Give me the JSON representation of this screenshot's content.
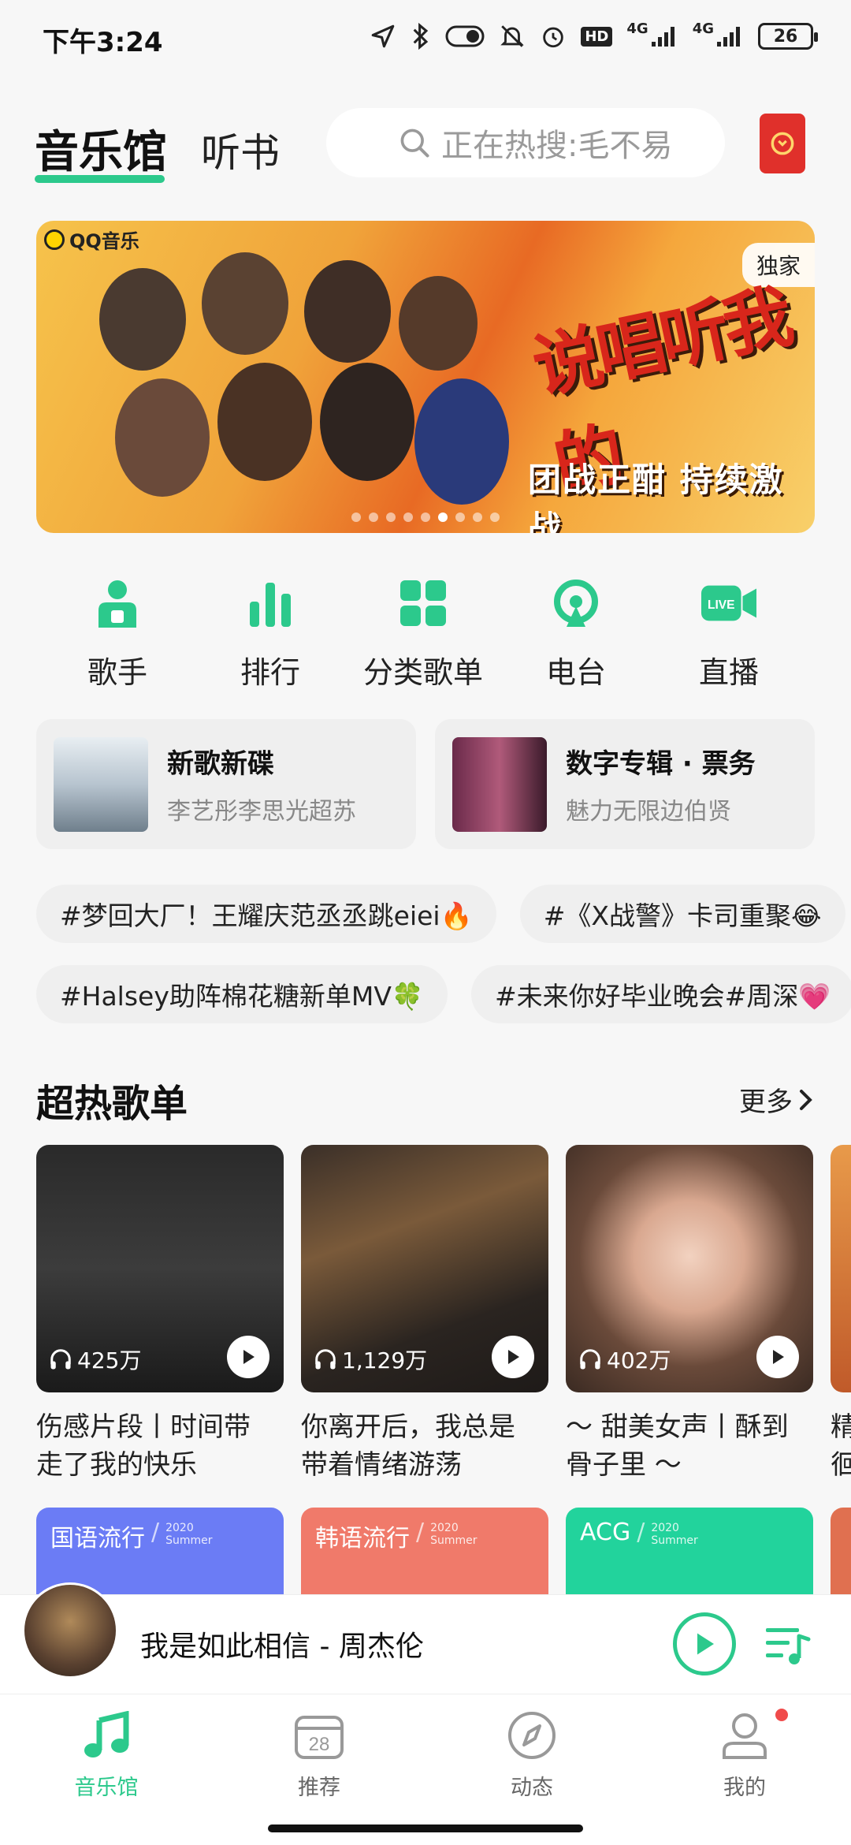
{
  "status_bar": {
    "time": "下午3:24",
    "network_1": "4G",
    "network_2": "4G",
    "hd": "HD",
    "battery": "26"
  },
  "header": {
    "tab_active": "音乐馆",
    "tab_second": "听书",
    "search_placeholder": "正在热搜:毛不易"
  },
  "banner": {
    "logo_text": "QQ音乐",
    "badge": "独家",
    "title": "说唱听我的",
    "slogan": "团战正酣 持续激战",
    "slide_count": 9,
    "active_slide": 5
  },
  "quick_nav": [
    {
      "label": "歌手",
      "icon": "singer-icon"
    },
    {
      "label": "排行",
      "icon": "ranking-icon"
    },
    {
      "label": "分类歌单",
      "icon": "category-icon"
    },
    {
      "label": "电台",
      "icon": "radio-icon"
    },
    {
      "label": "直播",
      "icon": "live-icon"
    }
  ],
  "album_cards": [
    {
      "title": "新歌新碟",
      "subtitle": "李艺彤李思光超苏"
    },
    {
      "title": "数字专辑 · 票务",
      "subtitle": "魅力无限边伯贤"
    }
  ],
  "hashtags_row1": [
    "#梦回大厂！王耀庆范丞丞跳eiei🔥",
    "#《X战警》卡司重聚😂"
  ],
  "hashtags_row2": [
    "#Halsey助阵棉花糖新单MV🍀",
    "#未来你好毕业晚会#周深💗"
  ],
  "section": {
    "title": "超热歌单",
    "more": "更多"
  },
  "playlists": [
    {
      "count": "425万",
      "name_line1": "伤感片段丨时间带",
      "name_line2": "走了我的快乐"
    },
    {
      "count": "1,129万",
      "name_line1": "你离开后，我总是",
      "name_line2": "带着情绪游荡"
    },
    {
      "count": "402万",
      "name_line1": "～ 甜美女声丨酥到",
      "name_line2": "骨子里 ～"
    },
    {
      "count": "",
      "name_line1": "精",
      "name_line2": "徊"
    }
  ],
  "genres": [
    {
      "label": "国语流行",
      "year": "2020",
      "season": "Summer",
      "color": "#6b7cf5"
    },
    {
      "label": "韩语流行",
      "year": "2020",
      "season": "Summer",
      "color": "#f07a6a"
    },
    {
      "label": "ACG",
      "year": "2020",
      "season": "Summer",
      "color": "#22d39c"
    },
    {
      "label": "",
      "year": "",
      "season": "",
      "color": "#e07050"
    }
  ],
  "player": {
    "song": "我是如此相信 - 周杰伦"
  },
  "bottom_nav": [
    {
      "label": "音乐馆",
      "icon": "music-note-icon",
      "active": true
    },
    {
      "label": "推荐",
      "icon": "calendar-icon",
      "date": "28",
      "active": false
    },
    {
      "label": "动态",
      "icon": "compass-icon",
      "active": false
    },
    {
      "label": "我的",
      "icon": "profile-icon",
      "active": false,
      "dot": true
    }
  ],
  "colors": {
    "accent": "#2cc98c",
    "badge_red": "#f04b4b"
  }
}
